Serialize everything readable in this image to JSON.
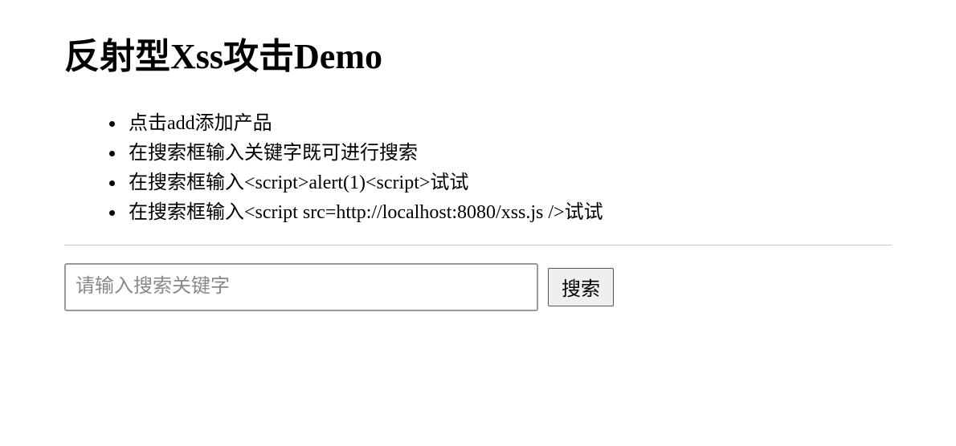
{
  "title": "反射型Xss攻击Demo",
  "instructions": [
    "点击add添加产品",
    "在搜索框输入关键字既可进行搜索",
    "在搜索框输入<script>alert(1)<script>试试",
    "在搜索框输入<script src=http://localhost:8080/xss.js />试试"
  ],
  "search": {
    "placeholder": "请输入搜索关键字",
    "value": "",
    "button_label": "搜索"
  }
}
